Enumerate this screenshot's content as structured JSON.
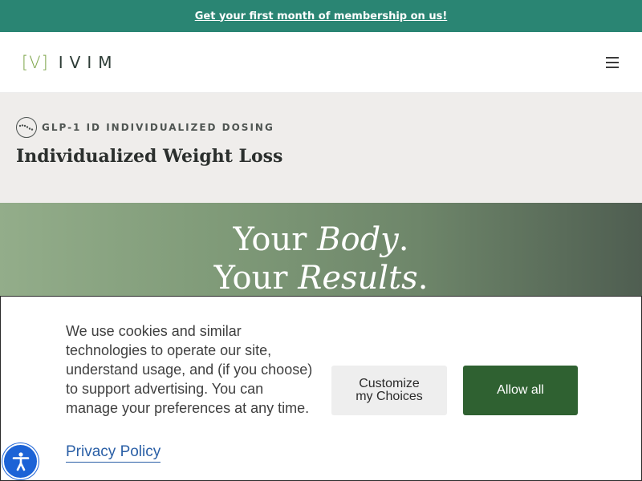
{
  "promo": {
    "text": "Get your first month of membership on us!"
  },
  "header": {
    "logo_mark": "[V]",
    "logo_text": "IVIM",
    "menu_icon": "hamburger-icon"
  },
  "intro": {
    "eyebrow": "GLP-1 ID INDIVIDUALIZED DOSING",
    "eyebrow_icon": "dotted-curve-icon",
    "title": "Individualized Weight Loss"
  },
  "hero": {
    "line1_prefix": "Your ",
    "line1_emphasis": "Body",
    "line1_suffix": ".",
    "line2_prefix": "Your ",
    "line2_emphasis": "Results",
    "line2_suffix": "."
  },
  "cookie_banner": {
    "message": "We use cookies and similar technologies to operate our site, understand usage, and (if you choose) to support advertising. You can manage your preferences at any time.",
    "privacy_link": "Privacy Policy",
    "customize_button": "Customize my Choices",
    "allow_button": "Allow all"
  },
  "accessibility": {
    "icon": "accessibility-icon"
  },
  "colors": {
    "promo_bg": "#2a8573",
    "accent_green": "#7ea64b",
    "allow_bg": "#2f6131",
    "link_blue": "#2a5fa6",
    "a11y_blue": "#1c63d6"
  }
}
